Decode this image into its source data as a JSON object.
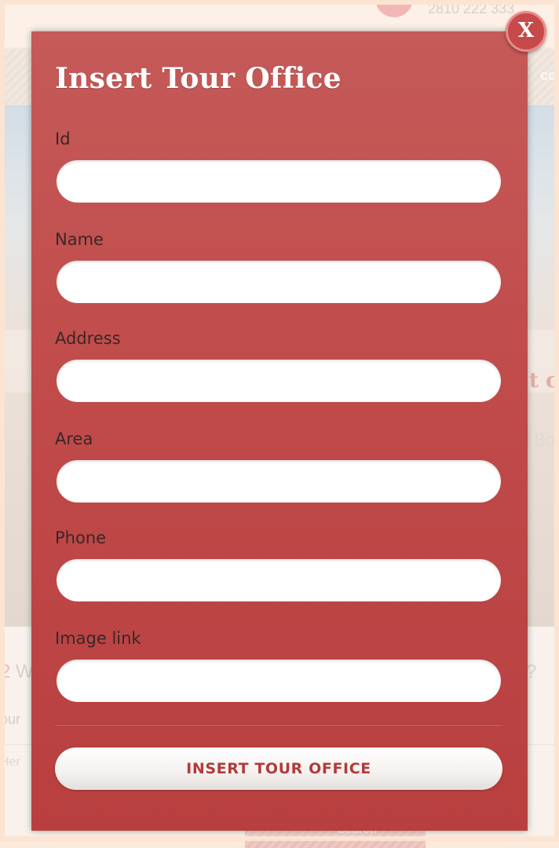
{
  "background": {
    "phone": "2810 222 333",
    "nav_text": "co",
    "hero_text_1": "t c",
    "hero_text_2": "Bo",
    "question_number": "2",
    "question_left": " W",
    "question_right": "?",
    "our_text": "our",
    "here_text": "Her",
    "bottom_button": "Search"
  },
  "modal": {
    "title": "Insert Tour Office",
    "close_label": "X",
    "fields": [
      {
        "label": "Id",
        "value": "",
        "placeholder": ""
      },
      {
        "label": "Name",
        "value": "",
        "placeholder": ""
      },
      {
        "label": "Address",
        "value": "",
        "placeholder": ""
      },
      {
        "label": "Area",
        "value": "",
        "placeholder": ""
      },
      {
        "label": "Phone",
        "value": "",
        "placeholder": ""
      },
      {
        "label": "Image link",
        "value": "",
        "placeholder": ""
      }
    ],
    "submit_label": "INSERT TOUR OFFICE"
  },
  "colors": {
    "modal_bg": "#c04b4a",
    "label_text": "#3b2626",
    "button_text": "#b23a3a",
    "page_bg": "#fbe9dc"
  }
}
